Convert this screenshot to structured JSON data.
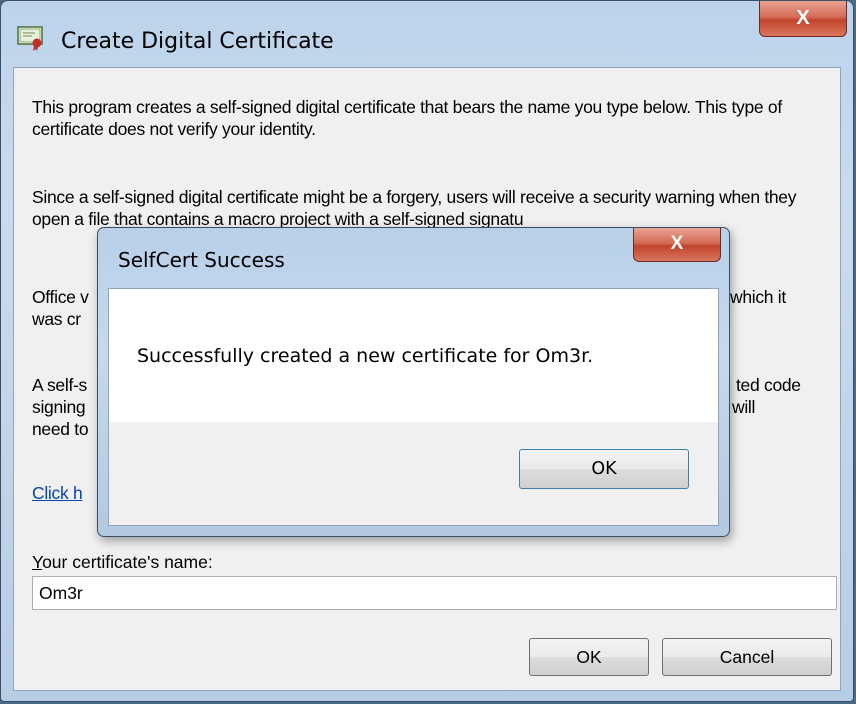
{
  "main_window": {
    "title": "Create Digital Certificate",
    "close_glyph": "X",
    "icon": "certificate-icon",
    "paragraph1": "This program creates a self-signed digital certificate that bears the name you type below. This type of certificate does not verify your identity.",
    "paragraph2": "Since a self-signed digital certificate might be a forgery, users will receive a security warning when they open a file that contains a macro project with a self-signed signatu",
    "paragraph3_line1": "Office v",
    "paragraph3_line1_end": "n which it",
    "paragraph3_line2": "was cr",
    "paragraph4_line1": "A self-s",
    "paragraph4_line1_end": "ted code",
    "paragraph4_line2": "signing",
    "paragraph4_line2_end": "will",
    "paragraph4_line3": "need to",
    "link_text": "Click h",
    "name_label": "Your certificate's name:",
    "name_label_mnemonic": "Y",
    "name_label_rest": "our certificate's name:",
    "name_value": "Om3r",
    "ok_label": "OK",
    "cancel_label": "Cancel"
  },
  "popup": {
    "title": "SelfCert Success",
    "close_glyph": "X",
    "message": "Successfully created a new certificate for Om3r.",
    "ok_label": "OK"
  }
}
